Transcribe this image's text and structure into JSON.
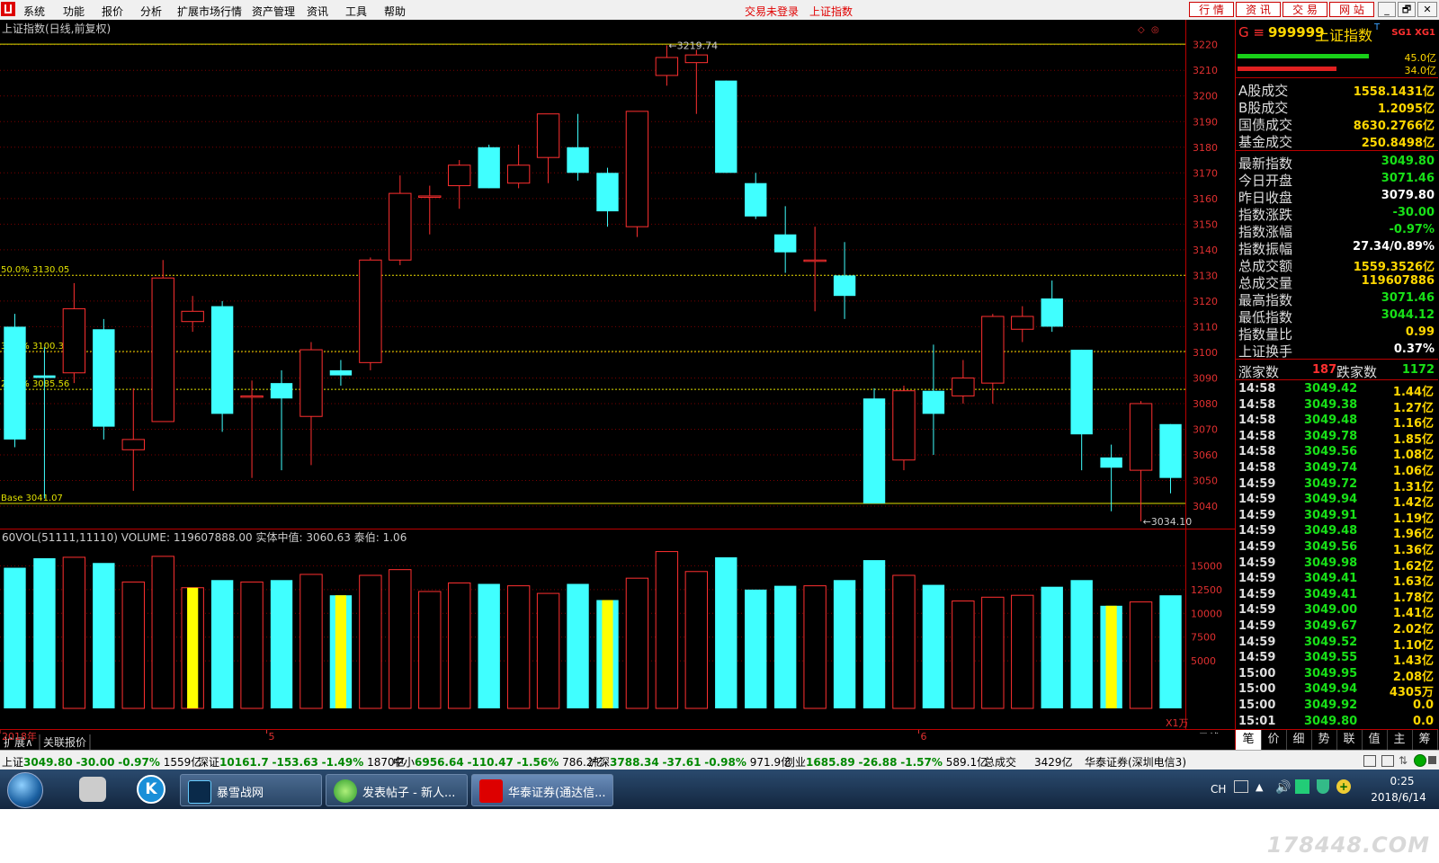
{
  "menubar": {
    "items": [
      "系统",
      "功能",
      "报价",
      "分析",
      "扩展市场行情",
      "资产管理",
      "资讯",
      "工具",
      "帮助"
    ],
    "status_login": "交易未登录",
    "status_index": "上证指数",
    "nav_buttons": [
      "行 情",
      "资 讯",
      "交 易",
      "网 站"
    ],
    "window_controls": [
      "_",
      "🗗",
      "🗖",
      "✕"
    ]
  },
  "chart": {
    "title": "上证指数(日线,前复权)",
    "fib_levels": [
      {
        "label": "50.0% 3130.05",
        "value": 3130.05
      },
      {
        "label": "33.3% 3100.33",
        "value": 3100.33
      },
      {
        "label": "25.0% 3085.56",
        "value": 3085.56
      },
      {
        "label": "Base 3041.07",
        "value": 3041.07
      }
    ],
    "high_marker": "3219.74",
    "low_marker": "3034.10",
    "vol_title": "60VOL(51111,11110) VOLUME: 119607888.00 实体中值: 3060.63 泰伯: 1.06",
    "vol_unit": "X1万",
    "date_labels": [
      {
        "label": "2018年",
        "index": 0
      },
      {
        "label": "5",
        "index": 9
      },
      {
        "label": "6",
        "index": 31
      }
    ],
    "period_label": "日线",
    "bottom_tabs": [
      "扩展∧",
      "关联报价"
    ],
    "price_axis": [
      "3220",
      "3210",
      "3200",
      "3190",
      "3180",
      "3170",
      "3160",
      "3150",
      "3140",
      "3130",
      "3120",
      "3110",
      "3100",
      "3090",
      "3080",
      "3070",
      "3060",
      "3050",
      "3040"
    ],
    "vol_axis": [
      "15000",
      "12500",
      "10000",
      "7500",
      "5000"
    ]
  },
  "chart_data": {
    "type": "candlestick",
    "price_range": [
      3033,
      3222
    ],
    "volume_range": [
      0,
      17500
    ],
    "candles": [
      {
        "o": 3110,
        "c": 3066,
        "h": 3115,
        "l": 3063,
        "v": 14800
      },
      {
        "o": 3091,
        "c": 3090,
        "h": 3102,
        "l": 3043,
        "v": 15800
      },
      {
        "o": 3092,
        "c": 3117,
        "h": 3127,
        "l": 3088,
        "v": 15900
      },
      {
        "o": 3109,
        "c": 3071,
        "h": 3113,
        "l": 3066,
        "v": 15300
      },
      {
        "o": 3062,
        "c": 3066,
        "h": 3086,
        "l": 3046,
        "v": 13300
      },
      {
        "o": 3073,
        "c": 3129,
        "h": 3136,
        "l": 3073,
        "v": 16000
      },
      {
        "o": 3112,
        "c": 3116,
        "h": 3122,
        "l": 3108,
        "v": 12700,
        "mark": true
      },
      {
        "o": 3118,
        "c": 3076,
        "h": 3120,
        "l": 3069,
        "v": 13500
      },
      {
        "o": 3083,
        "c": 3083,
        "h": 3089,
        "l": 3051,
        "v": 13300
      },
      {
        "o": 3088,
        "c": 3082,
        "h": 3093,
        "l": 3054,
        "v": 13500
      },
      {
        "o": 3075,
        "c": 3101,
        "h": 3104,
        "l": 3056,
        "v": 14100
      },
      {
        "o": 3093,
        "c": 3091,
        "h": 3097,
        "l": 3087,
        "v": 11900,
        "mark": true
      },
      {
        "o": 3096,
        "c": 3136,
        "h": 3137,
        "l": 3093,
        "v": 14000
      },
      {
        "o": 3136,
        "c": 3162,
        "h": 3169,
        "l": 3134,
        "v": 14600
      },
      {
        "o": 3161,
        "c": 3161,
        "h": 3165,
        "l": 3146,
        "v": 12300
      },
      {
        "o": 3165,
        "c": 3173,
        "h": 3175,
        "l": 3156,
        "v": 13200
      },
      {
        "o": 3180,
        "c": 3164,
        "h": 3181,
        "l": 3164,
        "v": 13100
      },
      {
        "o": 3166,
        "c": 3173,
        "h": 3181,
        "l": 3164,
        "v": 12900
      },
      {
        "o": 3176,
        "c": 3193,
        "h": 3193,
        "l": 3166,
        "v": 12100
      },
      {
        "o": 3180,
        "c": 3170,
        "h": 3193,
        "l": 3167,
        "v": 13100
      },
      {
        "o": 3170,
        "c": 3155,
        "h": 3172,
        "l": 3149,
        "v": 11400,
        "mark": true
      },
      {
        "o": 3149,
        "c": 3194,
        "h": 3194,
        "l": 3145,
        "v": 13700
      },
      {
        "o": 3208,
        "c": 3215,
        "h": 3219.74,
        "l": 3204,
        "v": 16500
      },
      {
        "o": 3213,
        "c": 3216,
        "h": 3218,
        "l": 3193,
        "v": 14400
      },
      {
        "o": 3206,
        "c": 3170,
        "h": 3206,
        "l": 3170,
        "v": 15900
      },
      {
        "o": 3166,
        "c": 3153,
        "h": 3170,
        "l": 3152,
        "v": 12500
      },
      {
        "o": 3146,
        "c": 3139,
        "h": 3157,
        "l": 3131,
        "v": 12900
      },
      {
        "o": 3136,
        "c": 3136,
        "h": 3149,
        "l": 3116,
        "v": 12900
      },
      {
        "o": 3130,
        "c": 3122,
        "h": 3143,
        "l": 3113,
        "v": 13500
      },
      {
        "o": 3082,
        "c": 3041.07,
        "h": 3086,
        "l": 3041.07,
        "v": 15600
      },
      {
        "o": 3058,
        "c": 3085,
        "h": 3087,
        "l": 3054,
        "v": 14000
      },
      {
        "o": 3085,
        "c": 3076,
        "h": 3103,
        "l": 3060,
        "v": 13000
      },
      {
        "o": 3083,
        "c": 3090,
        "h": 3097,
        "l": 3080,
        "v": 11300
      },
      {
        "o": 3088,
        "c": 3114,
        "h": 3115,
        "l": 3080,
        "v": 11700
      },
      {
        "o": 3109,
        "c": 3114,
        "h": 3118,
        "l": 3104,
        "v": 11900
      },
      {
        "o": 3121,
        "c": 3110,
        "h": 3128,
        "l": 3108,
        "v": 12800
      },
      {
        "o": 3101,
        "c": 3068,
        "h": 3101,
        "l": 3054,
        "v": 13500
      },
      {
        "o": 3059,
        "c": 3055,
        "h": 3064,
        "l": 3038,
        "v": 10800,
        "mark": true
      },
      {
        "o": 3054,
        "c": 3080,
        "h": 3081,
        "l": 3034.1,
        "v": 11200
      },
      {
        "o": 3072,
        "c": 3051,
        "h": 3072,
        "l": 3045,
        "v": 11900
      }
    ]
  },
  "right_panel": {
    "code_prefix": "G ≡",
    "code": "999999",
    "name": "上证指数",
    "name_sup": "T",
    "sg": "SG1 XG1",
    "bar_labels": [
      "45.0亿",
      "34.0亿"
    ],
    "turnover": [
      {
        "label": "A股成交",
        "value": "1558.1431亿"
      },
      {
        "label": "B股成交",
        "value": "1.2095亿"
      },
      {
        "label": "国债成交",
        "value": "8630.2766亿"
      },
      {
        "label": "基金成交",
        "value": "250.8498亿"
      }
    ],
    "stats": [
      {
        "label": "最新指数",
        "value": "3049.80",
        "color": "#18e018"
      },
      {
        "label": "今日开盘",
        "value": "3071.46",
        "color": "#18e018"
      },
      {
        "label": "昨日收盘",
        "value": "3079.80",
        "color": "#ffffff"
      },
      {
        "label": "指数涨跌",
        "value": "-30.00",
        "color": "#18e018"
      },
      {
        "label": "指数涨幅",
        "value": "-0.97%",
        "color": "#18e018"
      },
      {
        "label": "指数振幅",
        "value": "27.34/0.89%",
        "color": "#ffffff"
      },
      {
        "label": "总成交额",
        "value": "1559.3526亿",
        "color": "#ffd700"
      },
      {
        "label": "总成交量",
        "value": "119607886",
        "color": "#ffd700"
      },
      {
        "label": "最高指数",
        "value": "3071.46",
        "color": "#18e018"
      },
      {
        "label": "最低指数",
        "value": "3044.12",
        "color": "#18e018"
      },
      {
        "label": "指数量比",
        "value": "0.99",
        "color": "#ffd700"
      },
      {
        "label": "上证换手",
        "value": "0.37%",
        "color": "#ffffff"
      }
    ],
    "breadth": {
      "up_label": "涨家数",
      "up": "187",
      "down_label": "跌家数",
      "down": "1172"
    },
    "ticks": [
      {
        "t": "14:58",
        "p": "3049.42",
        "v": "1.44亿"
      },
      {
        "t": "14:58",
        "p": "3049.38",
        "v": "1.27亿"
      },
      {
        "t": "14:58",
        "p": "3049.48",
        "v": "1.16亿"
      },
      {
        "t": "14:58",
        "p": "3049.78",
        "v": "1.85亿"
      },
      {
        "t": "14:58",
        "p": "3049.56",
        "v": "1.08亿"
      },
      {
        "t": "14:58",
        "p": "3049.74",
        "v": "1.06亿"
      },
      {
        "t": "14:59",
        "p": "3049.72",
        "v": "1.31亿"
      },
      {
        "t": "14:59",
        "p": "3049.94",
        "v": "1.42亿"
      },
      {
        "t": "14:59",
        "p": "3049.91",
        "v": "1.19亿"
      },
      {
        "t": "14:59",
        "p": "3049.48",
        "v": "1.96亿"
      },
      {
        "t": "14:59",
        "p": "3049.56",
        "v": "1.36亿"
      },
      {
        "t": "14:59",
        "p": "3049.98",
        "v": "1.62亿"
      },
      {
        "t": "14:59",
        "p": "3049.41",
        "v": "1.63亿"
      },
      {
        "t": "14:59",
        "p": "3049.41",
        "v": "1.78亿"
      },
      {
        "t": "14:59",
        "p": "3049.00",
        "v": "1.41亿"
      },
      {
        "t": "14:59",
        "p": "3049.67",
        "v": "2.02亿"
      },
      {
        "t": "14:59",
        "p": "3049.52",
        "v": "1.10亿"
      },
      {
        "t": "14:59",
        "p": "3049.55",
        "v": "1.43亿"
      },
      {
        "t": "15:00",
        "p": "3049.95",
        "v": "2.08亿"
      },
      {
        "t": "15:00",
        "p": "3049.94",
        "v": "4305万"
      },
      {
        "t": "15:00",
        "p": "3049.92",
        "v": "0.0"
      },
      {
        "t": "15:01",
        "p": "3049.80",
        "v": "0.0"
      }
    ],
    "tabs": [
      "笔",
      "价",
      "细",
      "势",
      "联",
      "值",
      "主",
      "筹"
    ]
  },
  "index_bar": [
    {
      "name": "上证",
      "val": "3049.80",
      "chg": "-30.00",
      "pct": "-0.97%",
      "amt": "1559亿"
    },
    {
      "name": "深证",
      "val": "10161.7",
      "chg": "-153.63",
      "pct": "-1.49%",
      "amt": "1870亿"
    },
    {
      "name": "中小",
      "val": "6956.64",
      "chg": "-110.47",
      "pct": "-1.56%",
      "amt": "786.2亿"
    },
    {
      "name": "沪深",
      "val": "3788.34",
      "chg": "-37.61",
      "pct": "-0.98%",
      "amt": "971.9亿"
    },
    {
      "name": "创业",
      "val": "1685.89",
      "chg": "-26.88",
      "pct": "-1.57%",
      "amt": "589.1亿"
    }
  ],
  "index_bar_total": {
    "label": "总成交",
    "value": "3429亿"
  },
  "broker": "华泰证券(深圳电信3)",
  "taskbar": {
    "apps": [
      "暴雪战网",
      "发表帖子 - 新人...",
      "华泰证券(通达信..."
    ],
    "lang": "CH",
    "time": "0:25",
    "date": "2018/6/14"
  },
  "watermark": "178448.COM"
}
